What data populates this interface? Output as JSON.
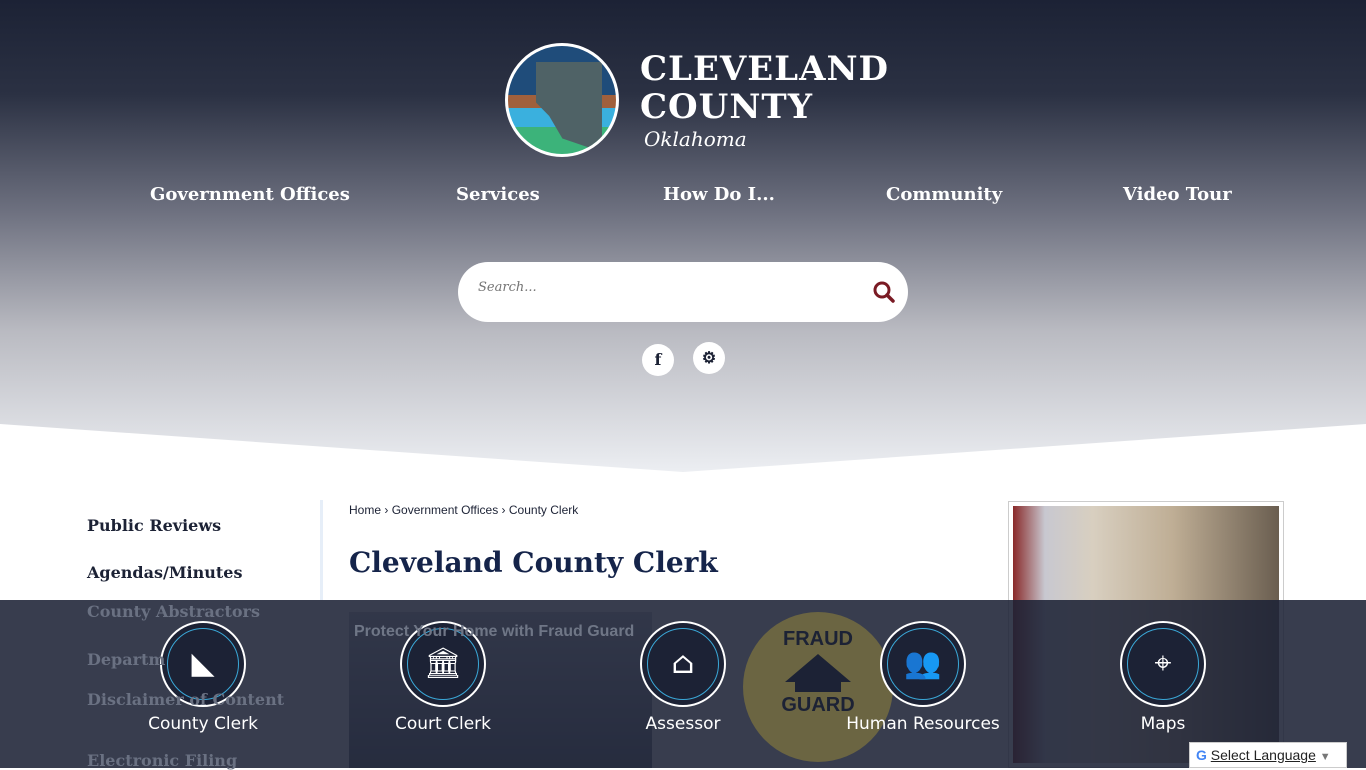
{
  "header": {
    "brand_line1": "CLEVELAND",
    "brand_line2": "COUNTY",
    "brand_sub": "Oklahoma"
  },
  "nav": [
    {
      "label": "Government Offices"
    },
    {
      "label": "Services"
    },
    {
      "label": "How Do I..."
    },
    {
      "label": "Community"
    },
    {
      "label": "Video Tour"
    }
  ],
  "search": {
    "placeholder": "Search..."
  },
  "social": {
    "facebook": "f",
    "settings": "⚙"
  },
  "sidebar": [
    {
      "label": "Public Reviews"
    },
    {
      "label": "Agendas/Minutes"
    },
    {
      "label": "County Abstractors"
    },
    {
      "label": "Departm"
    },
    {
      "label": "Disclaimer of Content"
    },
    {
      "label": "Electronic Filing"
    }
  ],
  "breadcrumb": {
    "home": "Home",
    "section": "Government Offices",
    "current": "County Clerk",
    "sep": "›"
  },
  "page_title": "Cleveland County Clerk",
  "promo": {
    "text": "Protect Your Home with Fraud Guard",
    "fraud_top": "FRAUD",
    "fraud_bottom": "GUARD"
  },
  "quick_links": [
    {
      "label": "County Clerk",
      "icon": "county-map-icon",
      "glyph": "◣"
    },
    {
      "label": "Court Clerk",
      "icon": "courthouse-icon",
      "glyph": "🏛"
    },
    {
      "label": "Assessor",
      "icon": "house-dollar-icon",
      "glyph": "⌂"
    },
    {
      "label": "Human Resources",
      "icon": "people-icon",
      "glyph": "👥"
    },
    {
      "label": "Maps",
      "icon": "map-pin-icon",
      "glyph": "⌖"
    }
  ],
  "translate": {
    "label": "Select Language",
    "arrow": "▼",
    "g": "G"
  },
  "colors": {
    "navy": "#1c2235",
    "accent": "#7a1b24",
    "ring": "#3aa8d8"
  }
}
